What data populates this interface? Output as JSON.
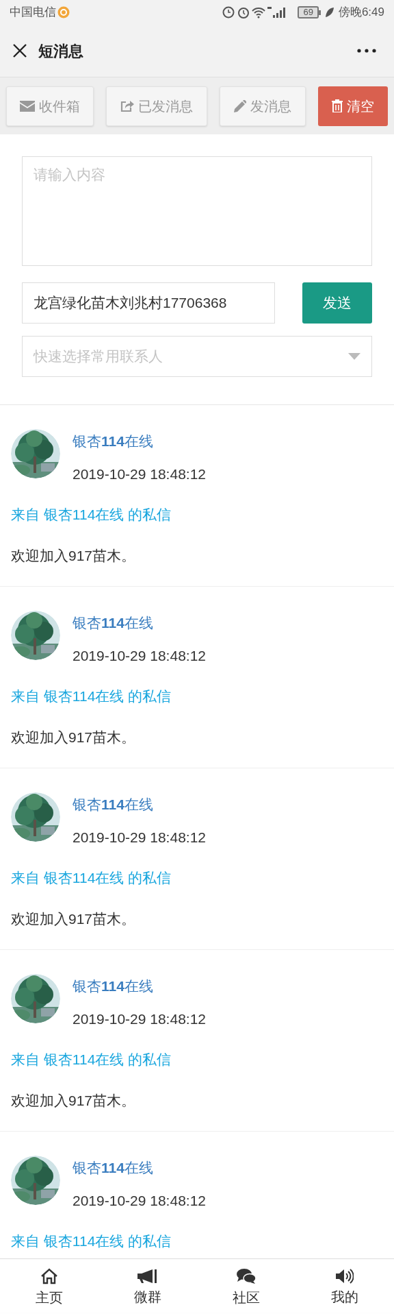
{
  "status_bar": {
    "carrier": "中国电信",
    "battery": "69",
    "time": "傍晚6:49"
  },
  "header": {
    "title": "短消息"
  },
  "toolbar": [
    {
      "label": "收件箱",
      "kind": "inbox"
    },
    {
      "label": "已发消息",
      "kind": "sent"
    },
    {
      "label": "发消息",
      "kind": "compose"
    },
    {
      "label": "清空",
      "kind": "clear"
    }
  ],
  "form": {
    "content_placeholder": "请输入内容",
    "recipient_value": "龙宫绿化苗木刘兆村17706368",
    "send_button": "发送",
    "contact_placeholder": "快速选择常用联系人"
  },
  "messages": [
    {
      "name": "银杏**114**在线",
      "time": "2019-10-29 18:48:12",
      "from": "来自 银杏114在线 的私信",
      "body": "欢迎加入917苗木。"
    },
    {
      "name": "银杏**114**在线",
      "time": "2019-10-29 18:48:12",
      "from": "来自 银杏114在线 的私信",
      "body": "欢迎加入917苗木。"
    },
    {
      "name": "银杏**114**在线",
      "time": "2019-10-29 18:48:12",
      "from": "来自 银杏114在线 的私信",
      "body": "欢迎加入917苗木。"
    },
    {
      "name": "银杏**114**在线",
      "time": "2019-10-29 18:48:12",
      "from": "来自 银杏114在线 的私信",
      "body": "欢迎加入917苗木。"
    },
    {
      "name": "银杏**114**在线",
      "time": "2019-10-29 18:48:12",
      "from": "来自 银杏114在线 的私信"
    }
  ],
  "bottom_nav": [
    {
      "label": "主页",
      "kind": "home"
    },
    {
      "label": "微群",
      "kind": "megaphone"
    },
    {
      "label": "社区",
      "kind": "chat"
    },
    {
      "label": "我的",
      "kind": "speaker"
    }
  ]
}
